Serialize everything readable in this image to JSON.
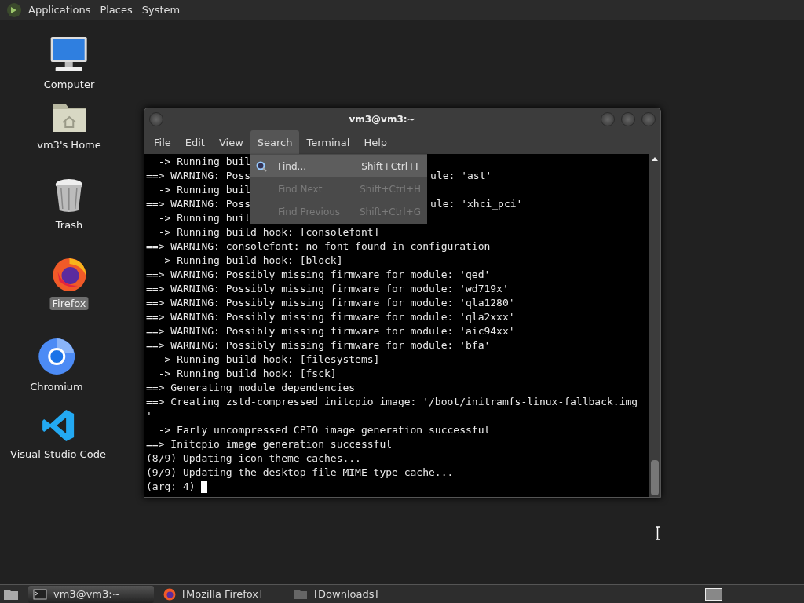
{
  "top_panel": {
    "menus": [
      "Applications",
      "Places",
      "System"
    ]
  },
  "desktop_icons": [
    {
      "label": "Computer",
      "selected": false
    },
    {
      "label": "vm3's Home",
      "selected": false
    },
    {
      "label": "Trash",
      "selected": false
    },
    {
      "label": "Firefox",
      "selected": true
    },
    {
      "label": "Chromium",
      "selected": false
    },
    {
      "label": "Visual Studio Code",
      "selected": false
    }
  ],
  "terminal": {
    "title": "vm3@vm3:~",
    "menubar": [
      {
        "label": "File",
        "selected": false
      },
      {
        "label": "Edit",
        "selected": false
      },
      {
        "label": "View",
        "selected": false
      },
      {
        "label": "Search",
        "selected": true
      },
      {
        "label": "Terminal",
        "selected": false
      },
      {
        "label": "Help",
        "selected": false
      }
    ],
    "search_menu": [
      {
        "label": "Find...",
        "shortcut": "Shift+Ctrl+F",
        "disabled": false,
        "selected": true
      },
      {
        "label": "Find Next",
        "shortcut": "Shift+Ctrl+H",
        "disabled": true,
        "selected": false
      },
      {
        "label": "Find Previous",
        "shortcut": "Shift+Ctrl+G",
        "disabled": true,
        "selected": false
      }
    ],
    "lines": [
      {
        "left": "  -> Running buil"
      },
      {
        "left": "==> WARNING: Poss",
        "right": "ule: 'ast'"
      },
      {
        "left": "  -> Running buil"
      },
      {
        "left": "==> WARNING: Poss",
        "right": "ule: 'xhci_pci'"
      },
      {
        "left": "  -> Running buil"
      },
      {
        "left": "  -> Running build hook: [consolefont]"
      },
      {
        "left": "==> WARNING: consolefont: no font found in configuration"
      },
      {
        "left": "  -> Running build hook: [block]"
      },
      {
        "left": "==> WARNING: Possibly missing firmware for module: 'qed'"
      },
      {
        "left": "==> WARNING: Possibly missing firmware for module: 'wd719x'"
      },
      {
        "left": "==> WARNING: Possibly missing firmware for module: 'qla1280'"
      },
      {
        "left": "==> WARNING: Possibly missing firmware for module: 'qla2xxx'"
      },
      {
        "left": "==> WARNING: Possibly missing firmware for module: 'aic94xx'"
      },
      {
        "left": "==> WARNING: Possibly missing firmware for module: 'bfa'"
      },
      {
        "left": "  -> Running build hook: [filesystems]"
      },
      {
        "left": "  -> Running build hook: [fsck]"
      },
      {
        "left": "==> Generating module dependencies"
      },
      {
        "left": "==> Creating zstd-compressed initcpio image: '/boot/initramfs-linux-fallback.img"
      },
      {
        "left": "'"
      },
      {
        "left": "  -> Early uncompressed CPIO image generation successful"
      },
      {
        "left": "==> Initcpio image generation successful"
      },
      {
        "left": "(8/9) Updating icon theme caches..."
      },
      {
        "left": "(9/9) Updating the desktop file MIME type cache..."
      },
      {
        "left": "(arg: 4) ",
        "cursor": true
      }
    ]
  },
  "taskbar": {
    "tasks": [
      {
        "label": "vm3@vm3:~",
        "selected": true
      },
      {
        "label": "[Mozilla Firefox]",
        "selected": false
      },
      {
        "label": "[Downloads]",
        "selected": false
      }
    ]
  }
}
